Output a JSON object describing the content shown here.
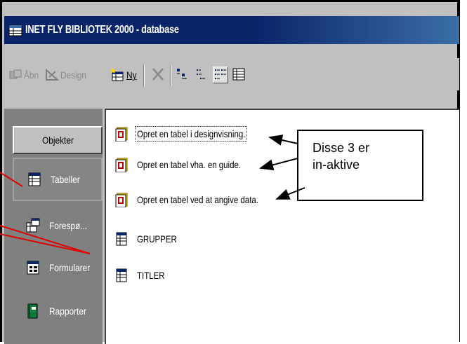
{
  "window": {
    "title": "INET FLY BIBLIOTEK 2000 - database"
  },
  "toolbar": {
    "open_label": "Åbn",
    "design_label": "Design",
    "new_label": "Ny",
    "delete_icon": "delete-x-icon",
    "view_icons": [
      "large-icons-view",
      "small-icons-view",
      "list-view",
      "details-view"
    ]
  },
  "sidebar": {
    "header": "Objekter",
    "items": [
      {
        "label": "Tabeller",
        "icon": "table-icon",
        "selected": true
      },
      {
        "label": "Forespø...",
        "icon": "query-icon"
      },
      {
        "label": "Formularer",
        "icon": "form-icon"
      },
      {
        "label": "Rapporter",
        "icon": "report-icon"
      }
    ]
  },
  "main": {
    "items": [
      {
        "label": "Opret en tabel i designvisning.",
        "icon": "shortcut-icon"
      },
      {
        "label": "Opret en tabel vha. en guide.",
        "icon": "shortcut-icon"
      },
      {
        "label": "Opret en tabel ved at angive data.",
        "icon": "shortcut-icon"
      },
      {
        "label": "GRUPPER",
        "icon": "table-icon"
      },
      {
        "label": "TITLER",
        "icon": "table-icon"
      }
    ]
  },
  "annotation": {
    "line1": "Disse 3 er",
    "line2": "in-aktive"
  },
  "colors": {
    "titlebar": "#0a246a",
    "sidebar": "#808080",
    "toolbar": "#c0c0c0",
    "pointer_lines": "#e00000"
  }
}
